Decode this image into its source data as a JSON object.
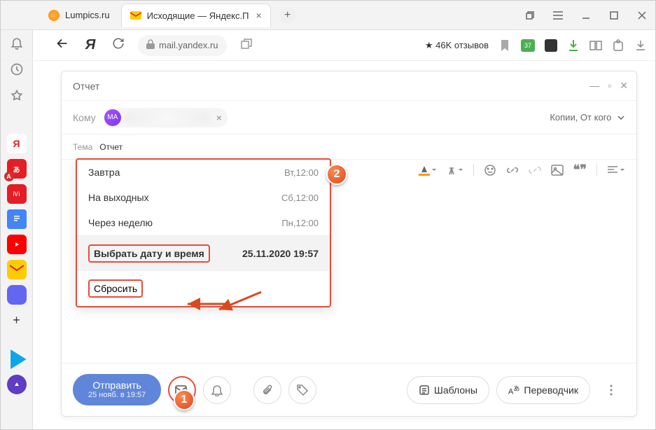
{
  "tabs": [
    {
      "title": "Lumpics.ru"
    },
    {
      "title": "Исходящие — Яндекс.П"
    }
  ],
  "address": "mail.yandex.ru",
  "reviews": "46K отзывов",
  "ext_calendar_badge": "37",
  "compose": {
    "title": "Отчет",
    "to_label": "Кому",
    "recipient_initials": "MA",
    "copies_label": "Копии, От кого",
    "subject_label": "Тема",
    "subject_value": "Отчет"
  },
  "schedule": {
    "rows": [
      {
        "label": "Завтра",
        "time": "Вт,12:00"
      },
      {
        "label": "На выходных",
        "time": "Сб,12:00"
      },
      {
        "label": "Через неделю",
        "time": "Пн,12:00"
      }
    ],
    "custom_label": "Выбрать дату и время",
    "custom_time": "25.11.2020 19:57",
    "reset_label": "Сбросить"
  },
  "bottom": {
    "send_label": "Отправить",
    "send_sub": "25 нояб. в 19:57",
    "templates_label": "Шаблоны",
    "translator_label": "Переводчик"
  },
  "callouts": {
    "one": "1",
    "two": "2"
  }
}
